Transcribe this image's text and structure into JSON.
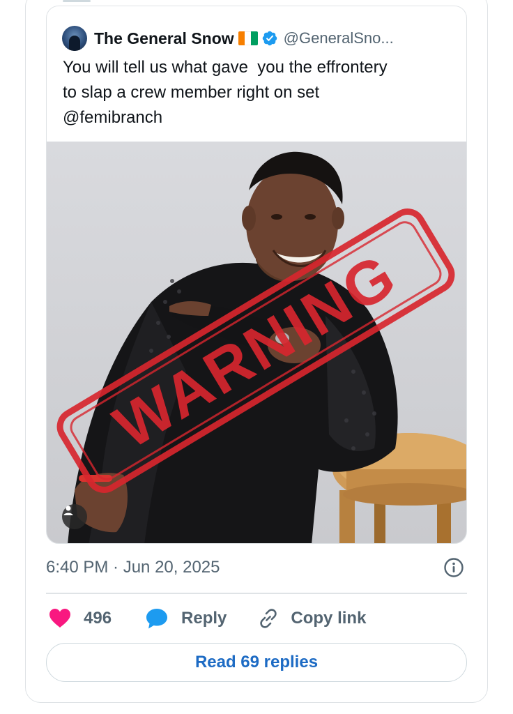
{
  "quoted_tweet": {
    "display_name": "The General Snow",
    "handle": "@GeneralSno...",
    "flag": {
      "colors": [
        "#f77f00",
        "#ffffff",
        "#009e60"
      ]
    },
    "text": "You will tell us what gave  you the effrontery\nto slap a crew member right on set\n@femibranch",
    "media": {
      "overlay_stamp": "WARNING",
      "stamp_color": "#d7262e"
    }
  },
  "timestamp": "6:40 PM · Jun 20, 2025",
  "actions": {
    "like_count": "496",
    "reply_label": "Reply",
    "copy_link_label": "Copy link"
  },
  "read_replies_label": "Read 69 replies",
  "colors": {
    "like": "#f91880",
    "reply": "#1d9bf0",
    "secondary_text": "#536471",
    "link_blue": "#1d6bc4",
    "border": "#dfe3e6",
    "verified": "#1d9bf0"
  },
  "icons": [
    "verified-badge-icon",
    "info-icon",
    "heart-icon",
    "chat-bubble-icon",
    "link-icon",
    "person-tag-icon"
  ]
}
